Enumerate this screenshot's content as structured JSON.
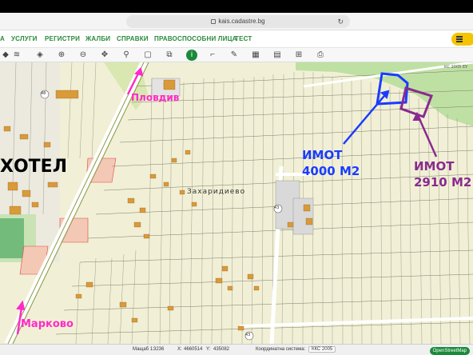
{
  "browser": {
    "url": "kais.cadastre.bg"
  },
  "nav": {
    "items": [
      "А",
      "УСЛУГИ",
      "РЕГИСТРИ",
      "ЖАЛБИ",
      "СПРАВКИ",
      "ПРАВОСПОСОБНИ ЛИЦА",
      "ТЕСТ"
    ]
  },
  "toolbar": {
    "icons": [
      "layers-icon",
      "layers-stack-icon",
      "zoom-in-icon",
      "zoom-out-icon",
      "pan-icon",
      "marker-icon",
      "select-box-icon",
      "export-box-icon",
      "info-icon",
      "measure-icon",
      "draw-icon",
      "map-icon",
      "document-icon",
      "print-icon"
    ]
  },
  "map": {
    "labels": {
      "hotel": "ХОТЕЛ",
      "plovdiv": "Пловдив",
      "markovo": "Марково",
      "village": "Захаридиево",
      "road_43": "43",
      "road_43b": "43",
      "road_48": "48",
      "imot1_title": "ИМОТ",
      "imot1_area": "4000 М2",
      "imot2_title": "ИМОТ",
      "imot2_area": "2910 М2",
      "corner_code": "КС 2005 ЕУ"
    },
    "colors": {
      "imot1": "#1a3cff",
      "imot2": "#8a2a8f",
      "city_arrow": "#ff2ac8",
      "road": "#8a9a4a",
      "parcel_line": "#777766",
      "building": "#d99a3a",
      "forest": "#a8c98a"
    }
  },
  "status": {
    "scale_label": "Мащаб 1:",
    "scale_value": "3236",
    "x_label": "X:",
    "x_value": "4660514",
    "y_label": "Y:",
    "y_value": "435082",
    "crs_label": "Координатна система:",
    "crs_value": "ККС 2005",
    "osm": "OpenStreetMap"
  }
}
